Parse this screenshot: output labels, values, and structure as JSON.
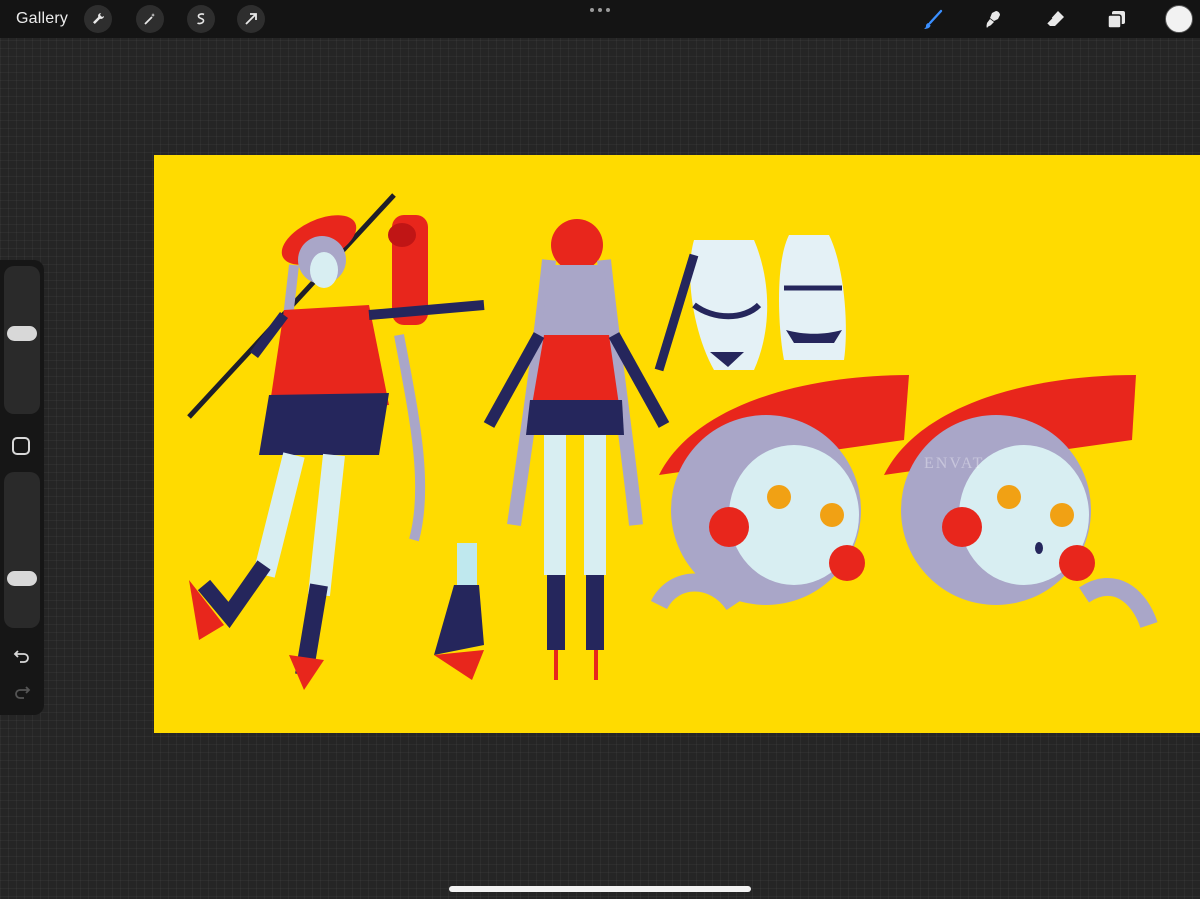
{
  "topbar": {
    "gallery_label": "Gallery",
    "left_tools": [
      "wrench-icon",
      "magic-wand-icon",
      "selection-icon",
      "transform-arrow-icon"
    ],
    "right_tools": [
      "brush-icon",
      "smudge-icon",
      "eraser-icon",
      "layers-icon"
    ],
    "active_tool": "brush-icon",
    "accent_color": "#3a8fff",
    "current_color": "#f2f2f2"
  },
  "sidebar": {
    "brush_size_level": 0.55,
    "opacity_level": 0.3,
    "modifier_icon": "square-modifier-icon",
    "undo_icon": "undo-icon",
    "redo_icon": "redo-icon"
  },
  "canvas": {
    "background_color": "#ffdb00",
    "artwork_description": "character-reference-sheet",
    "watermark_text": "ENVAT"
  }
}
